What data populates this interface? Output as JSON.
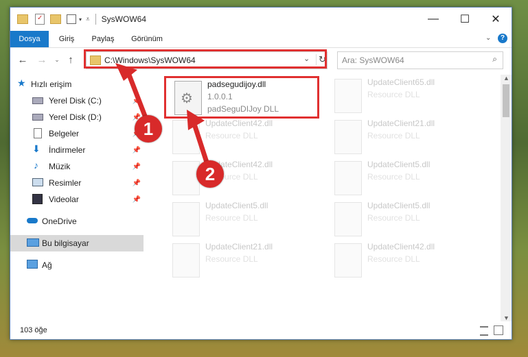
{
  "window": {
    "title": "SysWOW64",
    "controls": {
      "minimize": "—",
      "maximize": "☐",
      "close": "✕"
    }
  },
  "ribbon": {
    "tabs": [
      {
        "label": "Dosya",
        "active": true
      },
      {
        "label": "Giriş"
      },
      {
        "label": "Paylaş"
      },
      {
        "label": "Görünüm"
      }
    ]
  },
  "address": {
    "path": "C:\\Windows\\SysWOW64",
    "search_placeholder": "Ara: SysWOW64"
  },
  "sidebar": {
    "items": [
      {
        "label": "Hızlı erişim",
        "icon": "star-icon"
      },
      {
        "label": "Yerel Disk (C:)",
        "icon": "drive-icon"
      },
      {
        "label": "Yerel Disk (D:)",
        "icon": "drive-icon"
      },
      {
        "label": "Belgeler",
        "icon": "document-icon"
      },
      {
        "label": "İndirmeler",
        "icon": "download-icon"
      },
      {
        "label": "Müzik",
        "icon": "music-icon"
      },
      {
        "label": "Resimler",
        "icon": "pictures-icon"
      },
      {
        "label": "Videolar",
        "icon": "video-icon"
      },
      {
        "label": "OneDrive",
        "icon": "cloud-icon"
      },
      {
        "label": "Bu bilgisayar",
        "icon": "computer-icon",
        "selected": true
      },
      {
        "label": "Ağ",
        "icon": "network-icon"
      }
    ]
  },
  "files": [
    {
      "name": "padsegudijoy.dll",
      "line1": "1.0.0.1",
      "line2": "padSeguDIJoy DLL",
      "highlighted": true
    },
    {
      "name": "UpdateClient65.dll",
      "line1": "Resource DLL"
    },
    {
      "name": "UpdateClient42.dll",
      "line1": "Resource DLL"
    },
    {
      "name": "UpdateClient21.dll",
      "line1": "Resource DLL"
    },
    {
      "name": "UpdateClient42.dll",
      "line1": "Resource DLL"
    },
    {
      "name": "UpdateClient5.dll",
      "line1": "Resource DLL"
    },
    {
      "name": "UpdateClient5.dll",
      "line1": "Resource DLL"
    },
    {
      "name": "UpdateClient5.dll",
      "line1": "Resource DLL"
    },
    {
      "name": "UpdateClient21.dll",
      "line1": "Resource DLL"
    },
    {
      "name": "UpdateClient42.dll",
      "line1": "Resource DLL"
    }
  ],
  "status": {
    "count": "103 öğe"
  },
  "callouts": [
    "1",
    "2"
  ],
  "colors": {
    "accent": "#1979ca",
    "highlight": "#e03030",
    "callout": "#d82a2a"
  }
}
